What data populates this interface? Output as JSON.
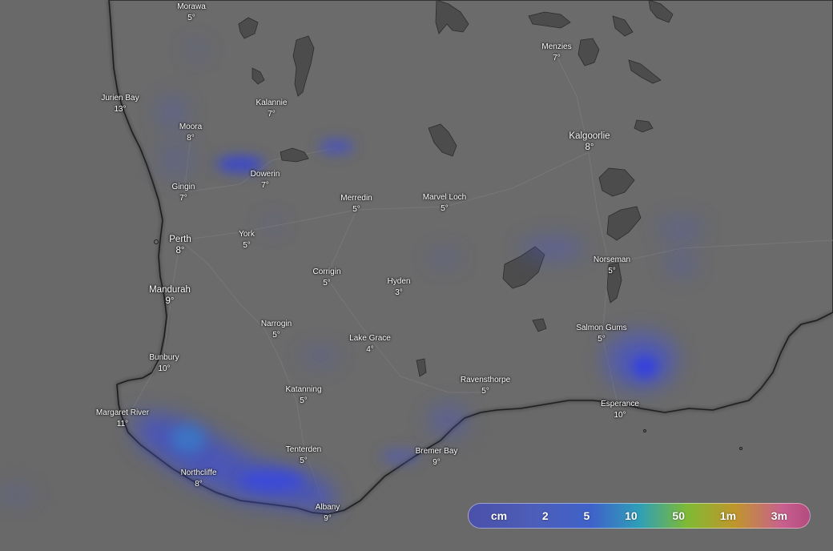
{
  "map": {
    "type": "weather-rain-map",
    "region_hint": "south-west"
  },
  "cities": [
    {
      "id": "morawa",
      "name": "Morawa",
      "temp": "5°"
    },
    {
      "id": "jurien-bay",
      "name": "Jurien Bay",
      "temp": "13°"
    },
    {
      "id": "kalannie",
      "name": "Kalannie",
      "temp": "7°"
    },
    {
      "id": "menzies",
      "name": "Menzies",
      "temp": "7°"
    },
    {
      "id": "moora",
      "name": "Moora",
      "temp": "8°"
    },
    {
      "id": "kalgoorlie",
      "name": "Kalgoorlie",
      "temp": "8°"
    },
    {
      "id": "dowerin",
      "name": "Dowerin",
      "temp": "7°"
    },
    {
      "id": "gingin",
      "name": "Gingin",
      "temp": "7°"
    },
    {
      "id": "merredin",
      "name": "Merredin",
      "temp": "5°"
    },
    {
      "id": "marvel-loch",
      "name": "Marvel Loch",
      "temp": "5°"
    },
    {
      "id": "perth",
      "name": "Perth",
      "temp": "8°"
    },
    {
      "id": "york",
      "name": "York",
      "temp": "5°"
    },
    {
      "id": "norseman",
      "name": "Norseman",
      "temp": "5°"
    },
    {
      "id": "corrigin",
      "name": "Corrigin",
      "temp": "5°"
    },
    {
      "id": "hyden",
      "name": "Hyden",
      "temp": "3°"
    },
    {
      "id": "mandurah",
      "name": "Mandurah",
      "temp": "9°"
    },
    {
      "id": "narrogin",
      "name": "Narrogin",
      "temp": "5°"
    },
    {
      "id": "salmon-gums",
      "name": "Salmon Gums",
      "temp": "5°"
    },
    {
      "id": "lake-grace",
      "name": "Lake Grace",
      "temp": "4°"
    },
    {
      "id": "bunbury",
      "name": "Bunbury",
      "temp": "10°"
    },
    {
      "id": "ravensthorpe",
      "name": "Ravensthorpe",
      "temp": "5°"
    },
    {
      "id": "katanning",
      "name": "Katanning",
      "temp": "5°"
    },
    {
      "id": "esperance",
      "name": "Esperance",
      "temp": "10°"
    },
    {
      "id": "margaret-river",
      "name": "Margaret River",
      "temp": "11°"
    },
    {
      "id": "tenterden",
      "name": "Tenterden",
      "temp": "5°"
    },
    {
      "id": "bremer-bay",
      "name": "Bremer Bay",
      "temp": "9°"
    },
    {
      "id": "northcliffe",
      "name": "Northcliffe",
      "temp": "8°"
    },
    {
      "id": "albany",
      "name": "Albany",
      "temp": "9°"
    }
  ],
  "legend": {
    "labels": [
      "cm",
      "2",
      "5",
      "10",
      "50",
      "1m",
      "3m"
    ],
    "colors": {
      "low": "#4a50a8",
      "mid": "#2e9fb8",
      "green": "#7fba34",
      "orange": "#c0962b",
      "high": "#b44a7e"
    }
  },
  "colors": {
    "land": "#6a6a6a",
    "ocean": "#6a6a6a",
    "coast": "#262626",
    "rain": "#3a48d8"
  }
}
